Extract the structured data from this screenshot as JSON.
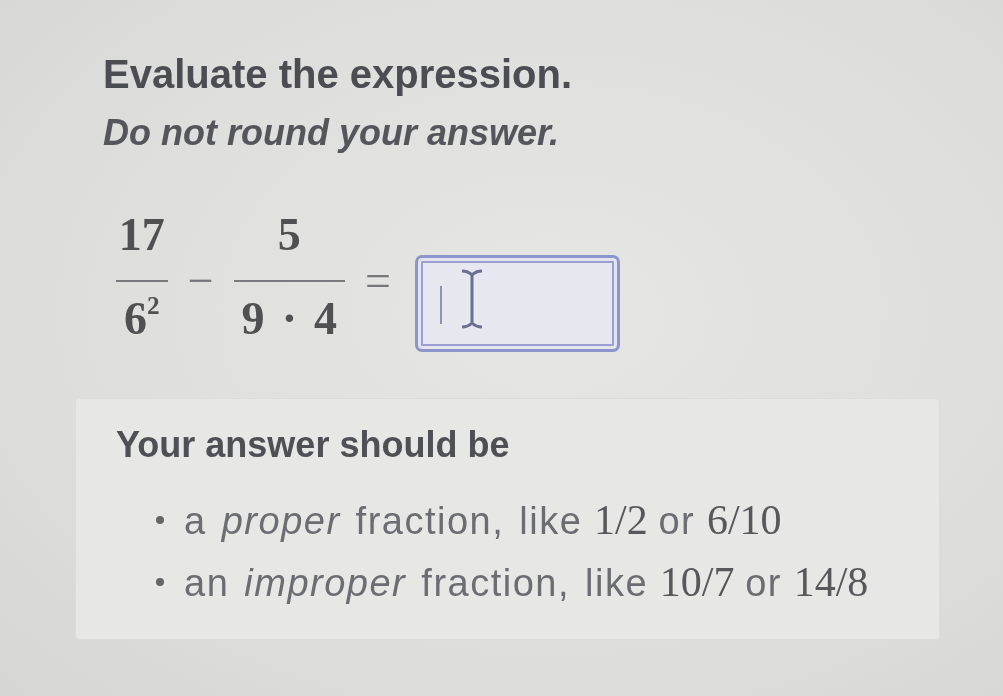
{
  "prompt": {
    "title": "Evaluate the expression.",
    "instruction": "Do not round your answer."
  },
  "expression": {
    "terms": [
      {
        "kind": "fraction",
        "numerator": "17",
        "denominator": "6$^{2}$"
      },
      {
        "kind": "operator",
        "symbol": "−"
      },
      {
        "kind": "fraction",
        "numerator": "5",
        "denominator": "9 · 4"
      },
      {
        "kind": "operator",
        "symbol": "="
      }
    ]
  },
  "answer_field": {
    "focused": true
  },
  "hint": {
    "title": "Your answer should be",
    "items": [
      {
        "parts": [
          {
            "kind": "text",
            "text": "a *proper* fraction, like"
          },
          {
            "kind": "math",
            "text": "1/2"
          },
          {
            "kind": "text",
            "text": "or"
          },
          {
            "kind": "math",
            "text": "6/10"
          }
        ]
      },
      {
        "parts": [
          {
            "kind": "text",
            "text": "an *improper* fraction, like"
          },
          {
            "kind": "math",
            "text": "10/7"
          },
          {
            "kind": "text",
            "text": "or"
          },
          {
            "kind": "math",
            "text": "14/8"
          }
        ]
      }
    ]
  }
}
